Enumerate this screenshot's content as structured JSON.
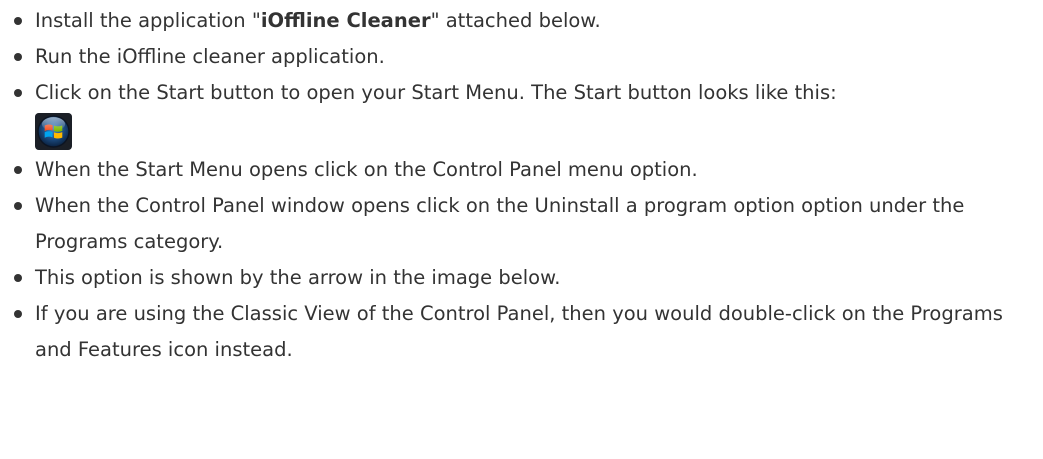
{
  "steps": [
    {
      "before": "Install the application \"",
      "bold": "iOffline Cleaner",
      "after": "\" attached below."
    },
    {
      "text": "Run the iOffline cleaner application."
    },
    {
      "text": "Click on the Start button to open your Start Menu. The Start button looks like this:",
      "icon": "windows-start-button-icon"
    },
    {
      "text": "When the Start Menu opens click on the Control Panel menu option."
    },
    {
      "text": "When the Control Panel window opens click on the Uninstall a program option option under the Programs category."
    },
    {
      "text": "This option is shown by the arrow in the image below."
    },
    {
      "text": "If you are using the Classic View of the Control Panel, then you would double-click on the Programs and Features icon instead."
    }
  ]
}
